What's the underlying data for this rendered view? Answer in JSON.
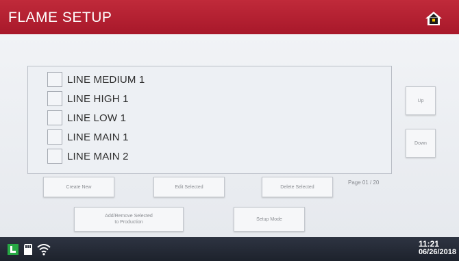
{
  "header": {
    "title": "FLAME SETUP",
    "home_icon": "home-icon"
  },
  "list": {
    "items": [
      {
        "label": "LINE MEDIUM 1"
      },
      {
        "label": "LINE HIGH 1"
      },
      {
        "label": "LINE LOW 1"
      },
      {
        "label": "LINE MAIN 1"
      },
      {
        "label": "LINE MAIN 2"
      }
    ]
  },
  "nav": {
    "up_label": "Up",
    "down_label": "Down"
  },
  "actions": {
    "create_new": "Create New",
    "edit_selected": "Edit Selected",
    "delete_selected": "Delete Selected",
    "add_remove": "Add/Remove Selected\nto Production",
    "setup_mode": "Setup Mode"
  },
  "page_indicator": "Page 01 / 20",
  "status": {
    "time": "11:21",
    "date": "06/26/2018",
    "icons": [
      "battery-icon",
      "sd-card-icon",
      "wifi-icon"
    ]
  },
  "colors": {
    "header": "#b01f2f",
    "statusbar": "#262b37",
    "battery": "#27a844"
  }
}
